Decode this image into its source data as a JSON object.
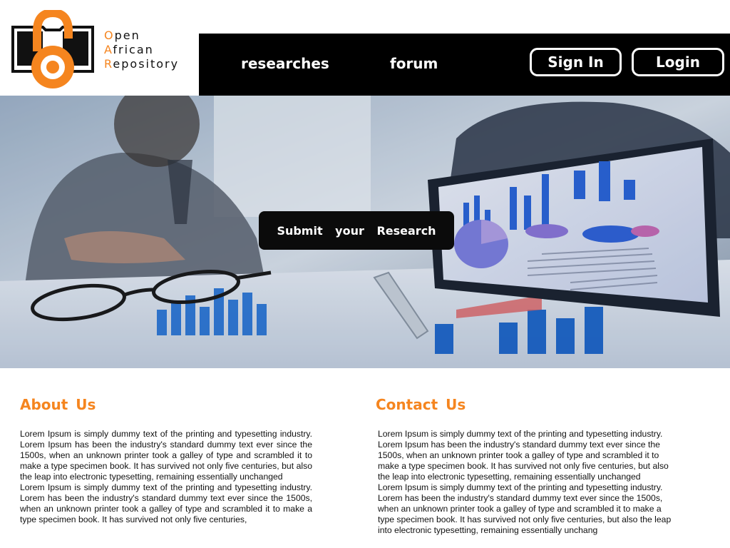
{
  "brand": {
    "lines": [
      {
        "first": "O",
        "rest": "pen"
      },
      {
        "first": "A",
        "rest": "frican"
      },
      {
        "first": "R",
        "rest": "epository"
      }
    ],
    "accent_color": "#f5851f"
  },
  "nav": {
    "links": [
      "researches",
      "forum"
    ],
    "sign_in": "Sign In",
    "login": "Login"
  },
  "hero": {
    "cta": "Submit your Research"
  },
  "about": {
    "title": "About Us",
    "paragraphs": [
      "Lorem Ipsum is simply dummy text of the printing and typesetting industry. Lorem Ipsum has been the industry's standard dummy text ever since the 1500s, when an unknown printer took a galley of type and scrambled it to make a type specimen book. It has survived not only five centuries, but also the leap into electronic typesetting, remaining essentially unchanged",
      "Lorem Ipsum is simply dummy text of the printing and typesetting industry. Lorem has been the industry's standard dummy text ever since the 1500s, when an unknown printer took a galley of type and scrambled it to make a type specimen book. It has survived not only five centuries,"
    ]
  },
  "contact": {
    "title": "Contact Us",
    "paragraphs": [
      "Lorem Ipsum is simply dummy text of the printing and typesetting industry. Lorem Ipsum has been the industry's standard dummy text ever since the 1500s, when an unknown printer took a galley of type and scrambled it to make a type specimen book. It has survived not only five centuries, but also the leap into electronic typesetting, remaining essentially unchanged",
      "Lorem Ipsum is simply dummy text of the printing and typesetting industry. Lorem has been the industry's standard dummy text ever since the 1500s, when an unknown printer took a galley of type and scrambled it to make a type specimen book. It has survived not only five centuries, but also the leap into electronic typesetting, remaining essentially unchang"
    ]
  }
}
